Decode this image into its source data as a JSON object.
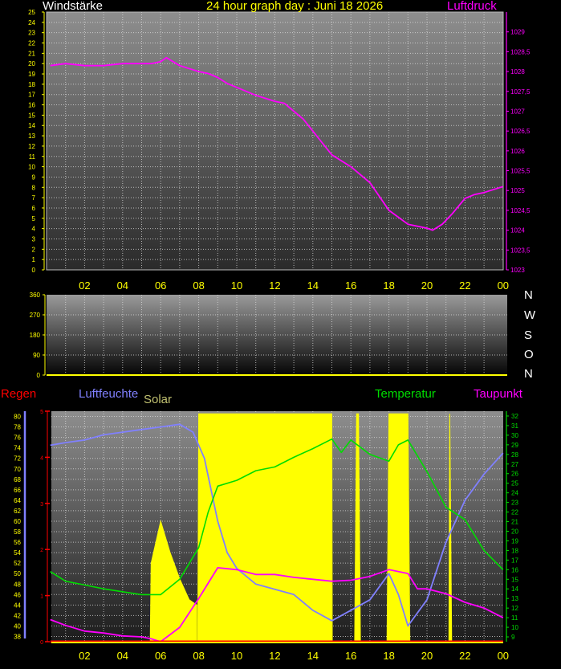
{
  "header": {
    "left_label": "Windstärke",
    "title": "24 hour graph day : Juni 18 2026",
    "right_label": "Luftdruck"
  },
  "compass": [
    "N",
    "W",
    "S",
    "O",
    "N"
  ],
  "bottom_labels": {
    "rain": "Regen",
    "humidity": "Luftfeuchte",
    "solar": "Solar",
    "temperature": "Temperatur",
    "dewpoint": "Taupunkt"
  },
  "colors": {
    "background": "#000000",
    "plot_bg_top": "#8c8c8c",
    "axis_label": "#ffff00",
    "pressure": "#ff00ff",
    "humidity": "#8080ff",
    "temperature": "#00dd00",
    "dewpoint": "#ff00ff",
    "solar": "#ffff00",
    "rain": "#ff0000"
  },
  "chart_data": [
    {
      "type": "line",
      "title": "24 hour graph day : Juni 18 2026",
      "x_ticks": [
        "02",
        "04",
        "06",
        "08",
        "10",
        "12",
        "14",
        "16",
        "18",
        "20",
        "22",
        "00"
      ],
      "left_axis": {
        "label": "Windstärke",
        "ylim": [
          0,
          25
        ],
        "ticks": [
          "0",
          "1",
          "2",
          "3",
          "4",
          "5",
          "6",
          "7",
          "8",
          "9",
          "10",
          "11",
          "12",
          "13",
          "14",
          "15",
          "16",
          "17",
          "18",
          "19",
          "20",
          "21",
          "22",
          "23",
          "24",
          "25"
        ]
      },
      "right_axis": {
        "label": "Luftdruck",
        "ylim": [
          1023,
          1029.5
        ],
        "ticks": [
          "1023",
          "1023,5",
          "1024",
          "1024,5",
          "1025",
          "1025,5",
          "1026",
          "1026,5",
          "1027",
          "1027,5",
          "1028",
          "1028,5",
          "1029"
        ]
      },
      "series": [
        {
          "name": "Luftdruck",
          "axis": "right",
          "x_hours": [
            0.2,
            1,
            2,
            3,
            4,
            5,
            5.5,
            6,
            6.3,
            7,
            8,
            8.5,
            9,
            9.5,
            10,
            11,
            12,
            12.5,
            13,
            13.5,
            14,
            14.5,
            15,
            16,
            17,
            18,
            19,
            20,
            20.3,
            20.8,
            21.3,
            22,
            22.5,
            23,
            24
          ],
          "values": [
            1028.15,
            1028.2,
            1028.15,
            1028.15,
            1028.2,
            1028.2,
            1028.2,
            1028.25,
            1028.35,
            1028.15,
            1028.0,
            1027.95,
            1027.85,
            1027.7,
            1027.6,
            1027.4,
            1027.25,
            1027.2,
            1027.0,
            1026.8,
            1026.5,
            1026.2,
            1025.9,
            1025.6,
            1025.2,
            1024.5,
            1024.15,
            1024.05,
            1024.0,
            1024.15,
            1024.4,
            1024.8,
            1024.9,
            1024.95,
            1025.1
          ]
        }
      ],
      "grid": true
    },
    {
      "type": "area",
      "title": "",
      "left_axis": {
        "ylim": [
          0,
          360
        ],
        "ticks": [
          "0",
          "90",
          "180",
          "270",
          "360"
        ]
      },
      "series": [],
      "grid": true
    },
    {
      "type": "line",
      "x_ticks": [
        "02",
        "04",
        "06",
        "08",
        "10",
        "12",
        "14",
        "16",
        "18",
        "20",
        "22",
        "00"
      ],
      "left_axis": {
        "label": "Luftfeuchte",
        "ylim": [
          37,
          81
        ],
        "ticks": [
          "38",
          "40",
          "42",
          "44",
          "46",
          "48",
          "50",
          "52",
          "54",
          "56",
          "58",
          "60",
          "62",
          "64",
          "66",
          "68",
          "70",
          "72",
          "74",
          "76",
          "78",
          "80"
        ]
      },
      "rain_axis": {
        "label": "Regen",
        "ylim": [
          0,
          5
        ],
        "ticks": [
          "0",
          "1",
          "2",
          "3",
          "4",
          "5"
        ]
      },
      "right_axis": {
        "label": "Temperatur",
        "ylim": [
          8.5,
          32.5
        ],
        "ticks": [
          "9",
          "10",
          "11",
          "12",
          "13",
          "14",
          "15",
          "16",
          "17",
          "18",
          "19",
          "20",
          "21",
          "22",
          "23",
          "24",
          "25",
          "26",
          "27",
          "28",
          "29",
          "30",
          "31",
          "32"
        ]
      },
      "series": [
        {
          "name": "Luftfeuchte",
          "axis": "left",
          "x_hours": [
            0.2,
            1,
            2,
            3,
            4,
            5,
            6,
            7,
            7.7,
            8.3,
            9,
            9.5,
            10,
            11,
            12,
            13,
            14,
            15,
            16,
            17,
            18,
            18.5,
            19,
            20,
            21,
            22,
            23,
            24
          ],
          "values": [
            74.5,
            75,
            75.5,
            76.5,
            77,
            77.5,
            78,
            78.5,
            77,
            72,
            60,
            54,
            51,
            48,
            47,
            46,
            43,
            41,
            43,
            45,
            50,
            46,
            40,
            45,
            56,
            64,
            69,
            73
          ]
        },
        {
          "name": "Temperatur",
          "axis": "right",
          "x_hours": [
            0.2,
            1,
            2,
            3,
            4,
            5,
            6,
            7,
            8,
            8.5,
            9,
            10,
            11,
            12,
            13,
            14,
            15,
            15.5,
            16,
            17,
            18,
            18.5,
            19,
            20,
            21,
            22,
            23,
            24
          ],
          "values": [
            15.8,
            14.8,
            14.4,
            14.0,
            13.7,
            13.4,
            13.4,
            15.0,
            18.3,
            22.0,
            24.7,
            25.3,
            26.3,
            26.7,
            27.7,
            28.6,
            29.6,
            28.2,
            29.5,
            28.0,
            27.3,
            29.0,
            29.5,
            26.2,
            22.5,
            21.2,
            18.0,
            16.0
          ]
        },
        {
          "name": "Taupunkt",
          "axis": "right",
          "x_hours": [
            0.2,
            1,
            2,
            3,
            4,
            5,
            5.5,
            6,
            7,
            8,
            9,
            10,
            11,
            12,
            13,
            14,
            15,
            16,
            17,
            18,
            19,
            19.5,
            20,
            21,
            22,
            23,
            24
          ],
          "values": [
            10.8,
            10.2,
            9.6,
            9.4,
            9.1,
            9.0,
            8.8,
            8.5,
            10.0,
            13.0,
            16.2,
            16.0,
            15.5,
            15.5,
            15.2,
            15.0,
            14.8,
            14.9,
            15.3,
            16.0,
            15.6,
            14.0,
            14.0,
            13.5,
            12.6,
            12.0,
            11.0
          ]
        },
        {
          "name": "Solar",
          "type": "area",
          "segments": [
            {
              "x_hours": [
                5.45,
                5.5,
                6,
                6.5,
                7,
                7.5,
                7.9
              ],
              "values": [
                0,
                52,
                60,
                54,
                49,
                45,
                44
              ]
            },
            {
              "x_hours": [
                7.95,
                8.0,
                15.0,
                15.02
              ],
              "values": [
                0,
                80.5,
                80.5,
                0
              ]
            },
            {
              "x_hours": [
                16.2,
                16.3,
                16.4,
                16.5
              ],
              "values": [
                0,
                80.5,
                80.5,
                0
              ]
            },
            {
              "x_hours": [
                17.9,
                18.0,
                19.0,
                19.1
              ],
              "values": [
                0,
                80.5,
                80.5,
                0
              ]
            },
            {
              "x_hours": [
                21.15,
                21.2,
                21.3
              ],
              "values": [
                0,
                80.5,
                0
              ]
            }
          ]
        },
        {
          "name": "Regen",
          "axis": "rain",
          "x_hours": [
            0.2,
            24
          ],
          "values": [
            0,
            0
          ]
        }
      ],
      "grid": true
    }
  ]
}
